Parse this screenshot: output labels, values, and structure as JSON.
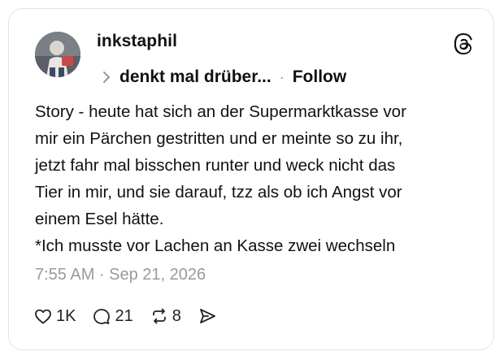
{
  "post": {
    "username": "inkstaphil",
    "subtitle": "denkt mal drüber...",
    "separator": "·",
    "follow_label": "Follow",
    "text_lines": [
      "Story - heute hat sich an der Supermarktkasse vor",
      "mir ein Pärchen gestritten und er meinte so zu ihr,",
      "jetzt fahr mal bisschen runter und weck nicht das",
      "Tier in mir, und sie darauf, tzz als ob ich Angst vor",
      "einem Esel hätte.",
      "*Ich musste vor Lachen an Kasse zwei wechseln"
    ],
    "timestamp": "7:55 AM · Sep 21, 2026"
  },
  "actions": {
    "likes": "1K",
    "replies": "21",
    "reposts": "8"
  },
  "icons": {
    "logo": "threads-logo-icon",
    "chevron": "chevron-right-icon",
    "like": "heart-icon",
    "reply": "comment-icon",
    "repost": "repost-icon",
    "share": "send-icon"
  },
  "colors": {
    "text": "#111111",
    "muted": "#9a9a9a",
    "border": "#e3e3e3"
  }
}
